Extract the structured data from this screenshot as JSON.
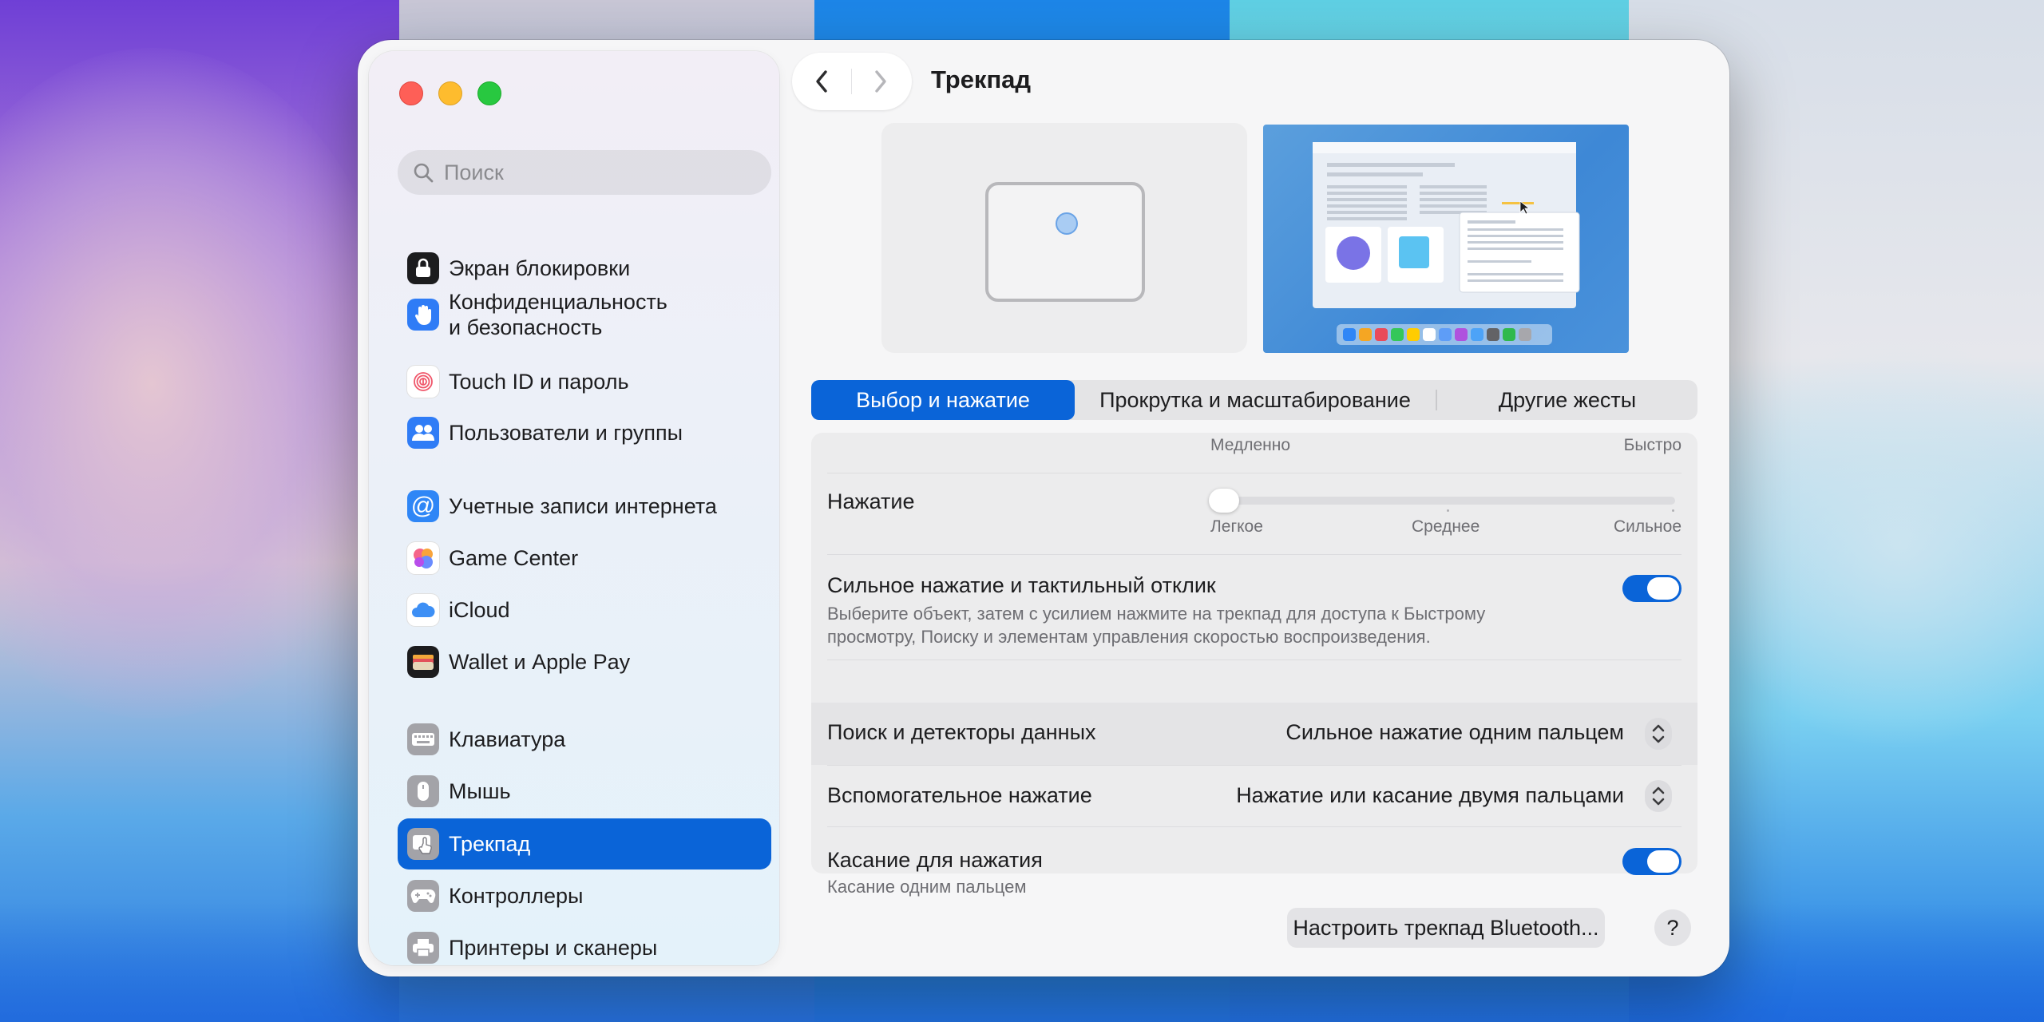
{
  "window": {
    "title": "Трекпад"
  },
  "search": {
    "placeholder": "Поиск"
  },
  "sidebar": {
    "items": [
      {
        "label": "Экран блокировки",
        "icon": "lock-icon",
        "color": "#1c1c1e"
      },
      {
        "label": "Конфиденциальность\nи безопасность",
        "icon": "hand-icon",
        "color": "#2f7cf6"
      },
      {
        "label": "Touch ID и пароль",
        "icon": "fingerprint-icon",
        "color": "#ffffff"
      },
      {
        "label": "Пользователи и группы",
        "icon": "users-icon",
        "color": "#2f7cf6"
      },
      {
        "label": "Учетные записи интернета",
        "icon": "at-icon",
        "color": "#2f86f6"
      },
      {
        "label": "Game Center",
        "icon": "game-center-icon",
        "color": "#ffffff"
      },
      {
        "label": "iCloud",
        "icon": "cloud-icon",
        "color": "#ffffff"
      },
      {
        "label": "Wallet и Apple Pay",
        "icon": "wallet-icon",
        "color": "#1c1c1e"
      },
      {
        "label": "Клавиатура",
        "icon": "keyboard-icon",
        "color": "#8e8e93"
      },
      {
        "label": "Мышь",
        "icon": "mouse-icon",
        "color": "#8e8e93"
      },
      {
        "label": "Трекпад",
        "icon": "trackpad-icon",
        "color": "#8e8e93",
        "active": true
      },
      {
        "label": "Контроллеры",
        "icon": "gamepad-icon",
        "color": "#8e8e93"
      },
      {
        "label": "Принтеры и сканеры",
        "icon": "printer-icon",
        "color": "#8e8e93"
      }
    ]
  },
  "tabs": [
    {
      "label": "Выбор и нажатие",
      "active": true
    },
    {
      "label": "Прокрутка и масштабирование"
    },
    {
      "label": "Другие жесты"
    }
  ],
  "settings": {
    "speed": {
      "min_label": "Медленно",
      "max_label": "Быстро"
    },
    "click": {
      "label": "Нажатие",
      "value_fraction": 0,
      "marks": [
        "Легкое",
        "Среднее",
        "Сильное"
      ]
    },
    "force_click": {
      "label": "Сильное нажатие и тактильный отклик",
      "description_line1": "Выберите объект, затем с усилием нажмите на трекпад для доступа к Быстрому",
      "description_line2": "просмотру, Поиску и элементам управления скоростью воспроизведения.",
      "enabled": true
    },
    "lookup": {
      "label": "Поиск и детекторы данных",
      "value": "Сильное нажатие одним пальцем"
    },
    "secondary_click": {
      "label": "Вспомогательное нажатие",
      "value": "Нажатие или касание двумя пальцами"
    },
    "tap_to_click": {
      "label": "Касание для нажатия",
      "description": "Касание одним пальцем",
      "enabled": true
    }
  },
  "footer": {
    "bluetooth_button": "Настроить трекпад Bluetooth...",
    "help_button": "?"
  },
  "colors": {
    "accent": "#0a64d8"
  }
}
